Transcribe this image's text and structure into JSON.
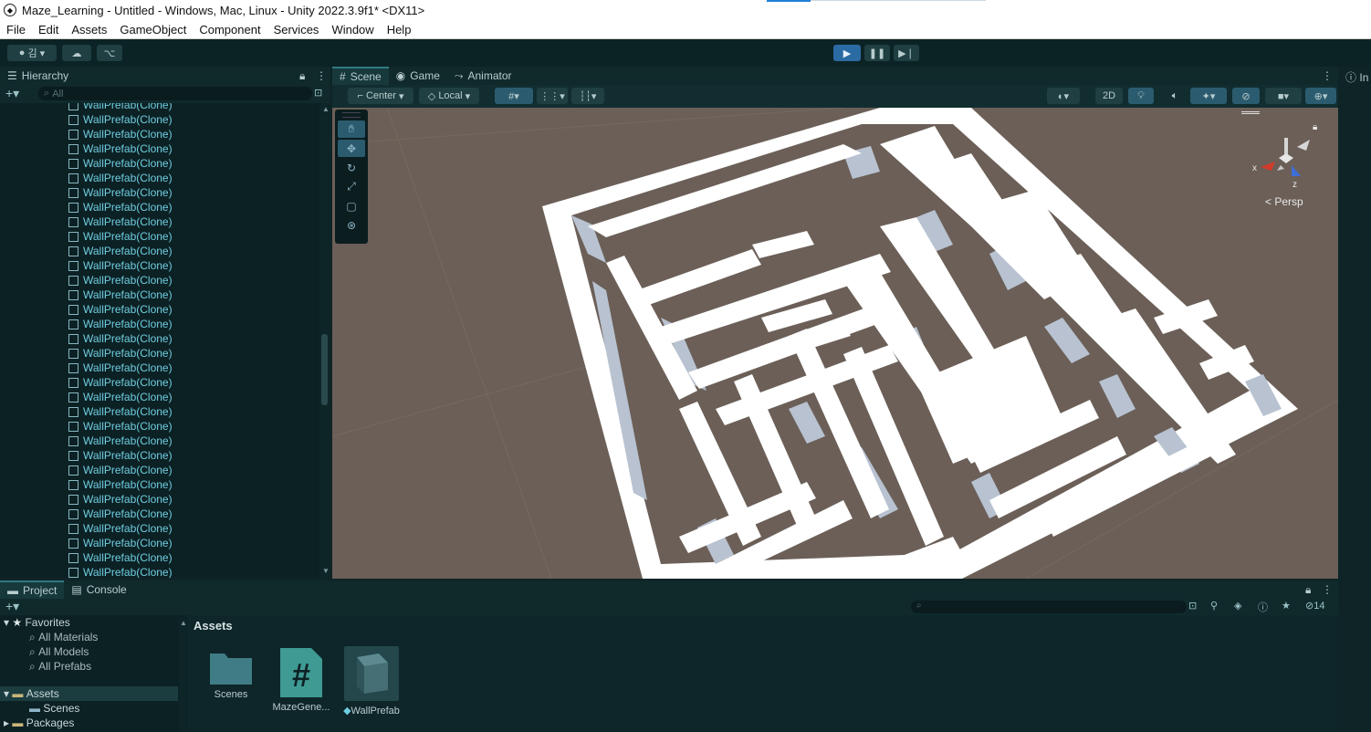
{
  "window": {
    "title": "Maze_Learning - Untitled - Windows, Mac, Linux - Unity 2022.3.9f1* <DX11>"
  },
  "menu": [
    "File",
    "Edit",
    "Assets",
    "GameObject",
    "Component",
    "Services",
    "Window",
    "Help"
  ],
  "toolbar": {
    "account_label": "김",
    "play_icon": "play-icon",
    "pause_icon": "pause-icon",
    "step_icon": "step-icon"
  },
  "hierarchy": {
    "tab_label": "Hierarchy",
    "search_placeholder": "All",
    "items": [
      "WallPrefab(Clone)",
      "WallPrefab(Clone)",
      "WallPrefab(Clone)",
      "WallPrefab(Clone)",
      "WallPrefab(Clone)",
      "WallPrefab(Clone)",
      "WallPrefab(Clone)",
      "WallPrefab(Clone)",
      "WallPrefab(Clone)",
      "WallPrefab(Clone)",
      "WallPrefab(Clone)",
      "WallPrefab(Clone)",
      "WallPrefab(Clone)",
      "WallPrefab(Clone)",
      "WallPrefab(Clone)",
      "WallPrefab(Clone)",
      "WallPrefab(Clone)",
      "WallPrefab(Clone)",
      "WallPrefab(Clone)",
      "WallPrefab(Clone)",
      "WallPrefab(Clone)",
      "WallPrefab(Clone)",
      "WallPrefab(Clone)",
      "WallPrefab(Clone)",
      "WallPrefab(Clone)",
      "WallPrefab(Clone)",
      "WallPrefab(Clone)",
      "WallPrefab(Clone)",
      "WallPrefab(Clone)",
      "WallPrefab(Clone)",
      "WallPrefab(Clone)",
      "WallPrefab(Clone)",
      "WallPrefab(Clone)"
    ]
  },
  "scene": {
    "tabs": [
      "Scene",
      "Game",
      "Animator"
    ],
    "pivot_label": "Center",
    "space_label": "Local",
    "mode_2d_label": "2D",
    "projection_label": "Persp",
    "gizmo_x": "x",
    "gizmo_z": "z"
  },
  "inspector": {
    "label": "In"
  },
  "project": {
    "tabs": [
      "Project",
      "Console"
    ],
    "hidden_count": "14",
    "favorites_label": "Favorites",
    "favorites": [
      "All Materials",
      "All Models",
      "All Prefabs"
    ],
    "assets_label": "Assets",
    "asset_folders": [
      "Scenes"
    ],
    "packages_label": "Packages",
    "breadcrumb": "Assets",
    "items": [
      {
        "name": "Scenes",
        "icon": "folder-icon"
      },
      {
        "name": "MazeGene...",
        "icon": "csharp-script-icon"
      },
      {
        "name": "WallPrefab",
        "icon": "prefab-cube-icon"
      }
    ]
  }
}
